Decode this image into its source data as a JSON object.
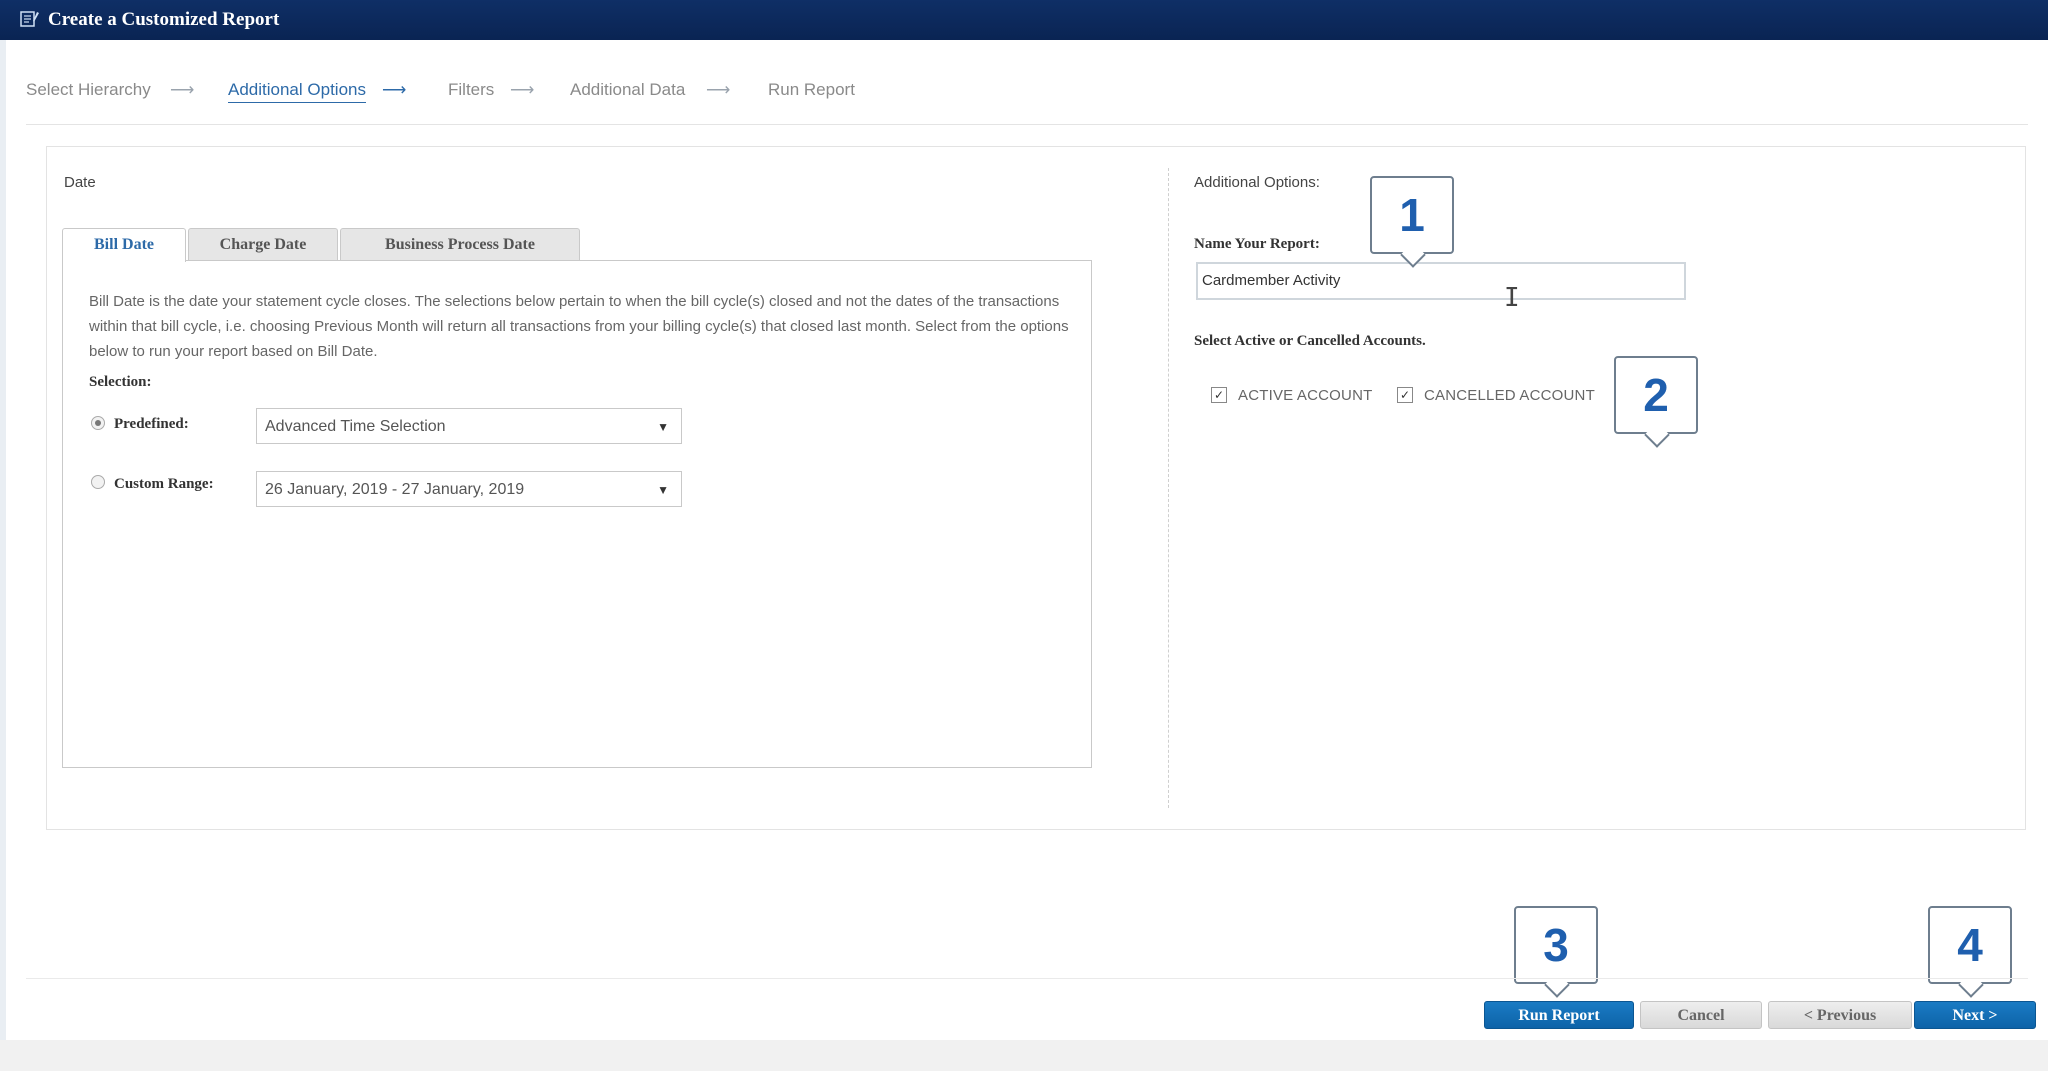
{
  "window": {
    "title": "Create a Customized Report",
    "icon": "report-icon"
  },
  "wizard": {
    "steps": [
      "Select Hierarchy",
      "Additional Options",
      "Filters",
      "Additional Data",
      "Run Report"
    ],
    "active_step": "Additional Options",
    "arrow": "⟶"
  },
  "date_section": {
    "label": "Date",
    "tabs": [
      "Bill Date",
      "Charge Date",
      "Business Process Date"
    ],
    "active_tab": "Bill Date",
    "description": "Bill Date is the date your statement cycle closes. The selections below pertain to when the bill cycle(s) closed and not the dates of the transactions within that bill cycle, i.e. choosing Previous Month will return all transactions from your billing cycle(s) that closed last month. Select from the options below to run your report based on Bill Date.",
    "selection_label": "Selection:",
    "predefined": {
      "label": "Predefined:",
      "value": "Advanced Time Selection",
      "selected": true
    },
    "custom_range": {
      "label": "Custom Range:",
      "value": "26 January, 2019 - 27 January, 2019",
      "selected": false
    }
  },
  "options_section": {
    "label": "Additional Options:",
    "name_label": "Name Your Report:",
    "name_value": "Cardmember Activity",
    "accounts_label": "Select Active or Cancelled Accounts.",
    "checkboxes": [
      {
        "label": "ACTIVE ACCOUNT",
        "checked": true
      },
      {
        "label": "CANCELLED ACCOUNT",
        "checked": true
      }
    ]
  },
  "callouts": [
    "1",
    "2",
    "3",
    "4"
  ],
  "buttons": {
    "run": "Run Report",
    "cancel": "Cancel",
    "previous": "< Previous",
    "next": "Next >"
  },
  "colors": {
    "titlebar": "#0a2453",
    "accent": "#2d6aa8",
    "primary_button": "#0d63a8",
    "callout_number": "#1f5fae"
  }
}
